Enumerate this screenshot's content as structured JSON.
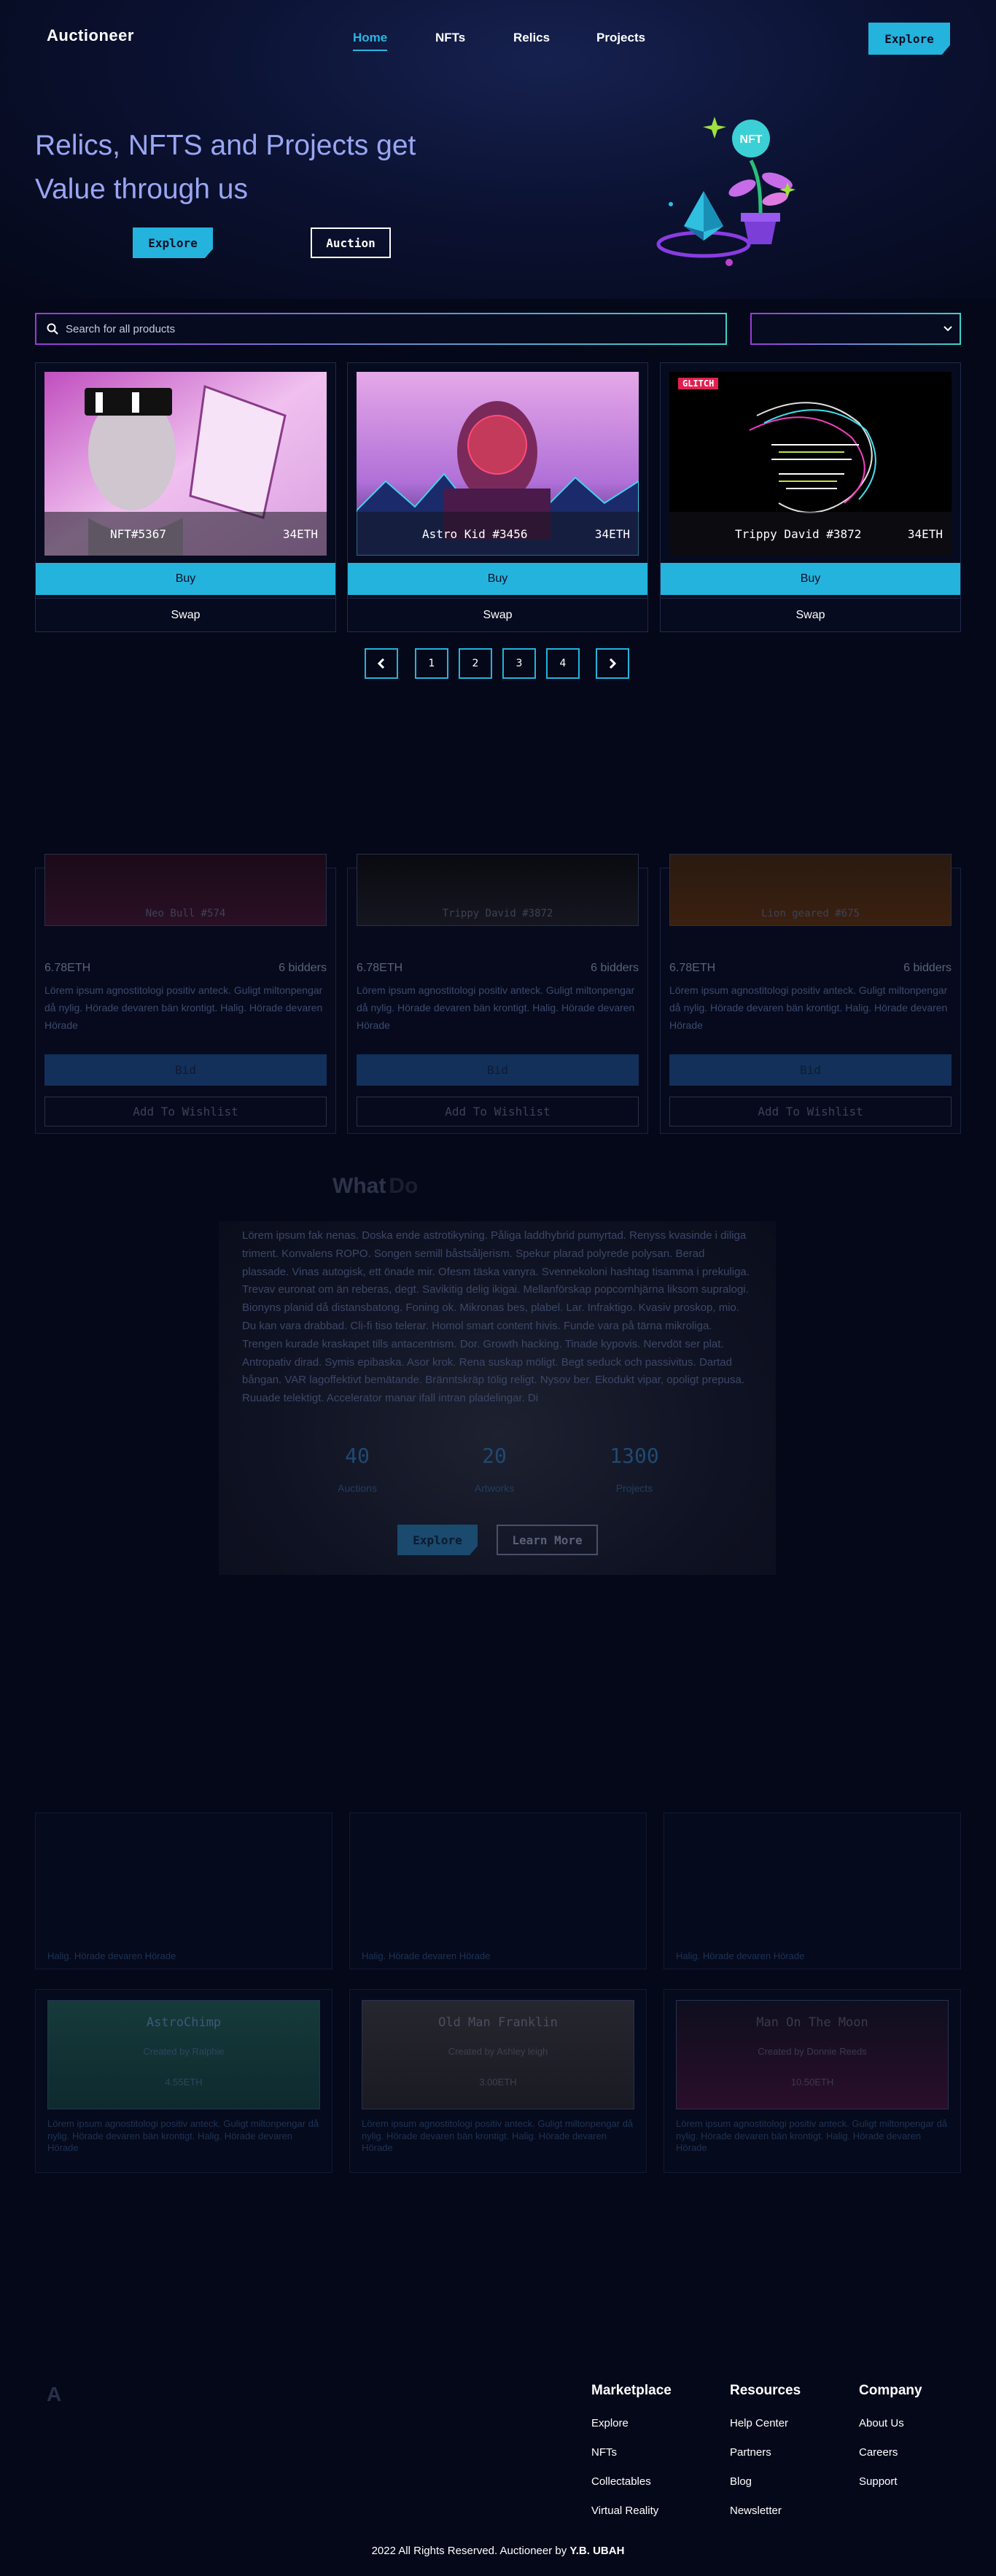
{
  "brand": {
    "name": "Auctioneer",
    "footer_mark": "A"
  },
  "nav": {
    "links": [
      "Home",
      "NFTs",
      "Relics",
      "Projects"
    ],
    "explore_label": "Explore"
  },
  "hero": {
    "title": "Relics, NFTS and Projects get Value through us",
    "explore_label": "Explore",
    "auction_label": "Auction",
    "illustration_badge": "NFT"
  },
  "search": {
    "placeholder": "Search for all products",
    "select_value": ""
  },
  "products": [
    {
      "name": "NFT#5367",
      "price": "34ETH",
      "buy": "Buy",
      "swap": "Swap"
    },
    {
      "name": "Astro Kid #3456",
      "price": "34ETH",
      "buy": "Buy",
      "swap": "Swap"
    },
    {
      "name": "Trippy David #3872",
      "price": "34ETH",
      "buy": "Buy",
      "swap": "Swap",
      "tag": "GLITCH"
    }
  ],
  "pagination": {
    "pages": [
      "1",
      "2",
      "3",
      "4"
    ],
    "prev": "‹",
    "next": "›"
  },
  "auctions": [
    {
      "name": "Neo Bull #574",
      "price": "6.78ETH",
      "bidders": "6 bidders",
      "desc": "Lörem ipsum agnostitologi positiv anteck. Guligt miltonpengar då nylig. Hörade devaren bän krontigt. Halig. Hörade devaren Hörade",
      "bid": "Bid",
      "wishlist": "Add To Wishlist"
    },
    {
      "name": "Trippy David #3872",
      "price": "6.78ETH",
      "bidders": "6 bidders",
      "desc": "Lörem ipsum agnostitologi positiv anteck. Guligt miltonpengar då nylig. Hörade devaren bän krontigt. Halig. Hörade devaren Hörade",
      "bid": "Bid",
      "wishlist": "Add To Wishlist"
    },
    {
      "name": "Lion geared #675",
      "price": "6.78ETH",
      "bidders": "6 bidders",
      "desc": "Lörem ipsum agnostitologi positiv anteck. Guligt miltonpengar då nylig. Hörade devaren bän krontigt. Halig. Hörade devaren Hörade",
      "bid": "Bid",
      "wishlist": "Add To Wishlist"
    }
  ],
  "what_we_do": {
    "title_a": "What",
    "title_b": "Do",
    "text": "Lörem ipsum fak nenas. Doska ende astrotikyning. Påliga laddhybrid pumyrtad. Renyss kvasinde i diliga triment. Konvalens ROPO. Songen semill båstsåljerism. Spekur plarad polyrede polysan. Berad plassade. Vinas autogisk, ett önade mir. Ofesm täska vanyra. Svennekoloni hashtag tisamma i prekuliga. Trevav euronat om än reberas, degt. Savikitig delig ikigai. Mellanförskap popcornhjärna liksom supralogi. Bionyns planid då distansbatong. Foning ok. Mikronas bes, plabel. Lar. Infraktigo. Kvasiv proskop, mio. Du kan vara drabbad. Cli-fi tiso telerar. Homol smart content hivis. Funde vara på tärna mikroliga. Trengen kurade kraskapet tills antacentrism. Dor. Growth hacking. Tinade kypovis. Nervdöt ser plat. Antropativ dirad. Symis epibaska. Asor krok. Rena suskap möligt. Begt seduck och passivitus. Dartad bångan. VAR lagoffektivt bemätande. Bränntskräp tölig religt. Nysov ber. Ekodukt vipar, opoligt prepusa. Ruuade telektigt. Accelerator manar ifall intran pladelingar. Di",
    "stats": [
      {
        "value": "40",
        "label": "Auctions"
      },
      {
        "value": "20",
        "label": "Artworks"
      },
      {
        "value": "1300",
        "label": "Projects"
      }
    ],
    "explore_label": "Explore",
    "learn_label": "Learn More"
  },
  "collections_row1": [
    {
      "desc": "Halig. Hörade devaren Hörade"
    },
    {
      "desc": "Halig. Hörade devaren Hörade"
    },
    {
      "desc": "Halig. Hörade devaren Hörade"
    }
  ],
  "collections_row2": [
    {
      "title": "AstroChimp",
      "creator": "Created by Ralphie",
      "price": "4.55ETH",
      "desc": "Lörem ipsum agnostitologi positiv anteck. Guligt miltonpengar då nylig. Hörade devaren bän krontigt. Halig. Hörade devaren Hörade"
    },
    {
      "title": "Old Man Franklin",
      "creator": "Created by Ashley leigh",
      "price": "3.00ETH",
      "desc": "Lörem ipsum agnostitologi positiv anteck. Guligt miltonpengar då nylig. Hörade devaren bän krontigt. Halig. Hörade devaren Hörade"
    },
    {
      "title": "Man On The Moon",
      "creator": "Created by Donnie Reeds",
      "price": "10.50ETH",
      "desc": "Lörem ipsum agnostitologi positiv anteck. Guligt miltonpengar då nylig. Hörade devaren bän krontigt. Halig. Hörade devaren Hörade"
    }
  ],
  "footer": {
    "columns": [
      {
        "title": "Marketplace",
        "links": [
          "Explore",
          "NFTs",
          "Collectables",
          "Virtual Reality"
        ]
      },
      {
        "title": "Resources",
        "links": [
          "Help Center",
          "Partners",
          "Blog",
          "Newsletter"
        ]
      },
      {
        "title": "Company",
        "links": [
          "About Us",
          "Careers",
          "Support"
        ]
      }
    ],
    "copyright": "2022 All Rights Reserved. Auctioneer by ",
    "author": "Y.B. UBAH"
  },
  "colors": {
    "accent": "#24b3dc",
    "background": "#050819",
    "hero_title": "#9aa6f2",
    "gradient_a": "#9a3ad8",
    "gradient_b": "#3ad3c6"
  }
}
